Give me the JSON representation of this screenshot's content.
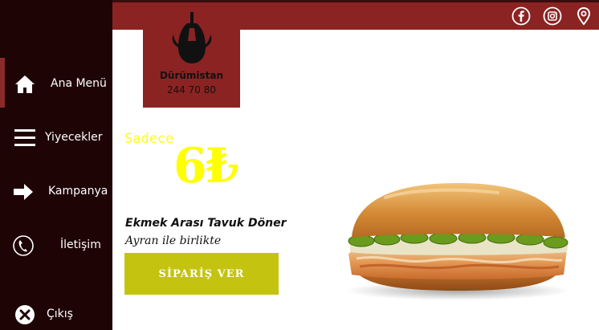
{
  "brand": {
    "name": "Dürümistan",
    "phone": "244 70 80",
    "logo_icon": "doner-kebab-icon",
    "color": "#8b2323"
  },
  "sidebar": {
    "background": "#1f0406",
    "items": [
      {
        "label": "Ana Menü",
        "icon": "home-icon",
        "active": true
      },
      {
        "label": "Yiyecekler",
        "icon": "menu-icon"
      },
      {
        "label": "Kampanya",
        "icon": "arrow-right-icon"
      },
      {
        "label": "İletişim",
        "icon": "phone-icon"
      },
      {
        "label": "Çıkış",
        "icon": "close-icon"
      }
    ]
  },
  "header": {
    "social": [
      {
        "icon": "facebook-icon"
      },
      {
        "icon": "instagram-icon"
      },
      {
        "icon": "location-pin-icon"
      }
    ]
  },
  "promo": {
    "prefix": "Sadece",
    "price": "6₺",
    "product_name": "Ekmek Arası Tavuk Döner",
    "product_desc": "Ayran ile birlikte",
    "order_label": "SİPARİŞ VER",
    "price_color": "#ffff00",
    "button_color": "#c4c410"
  },
  "image": {
    "icon": "chicken-sandwich-image"
  }
}
